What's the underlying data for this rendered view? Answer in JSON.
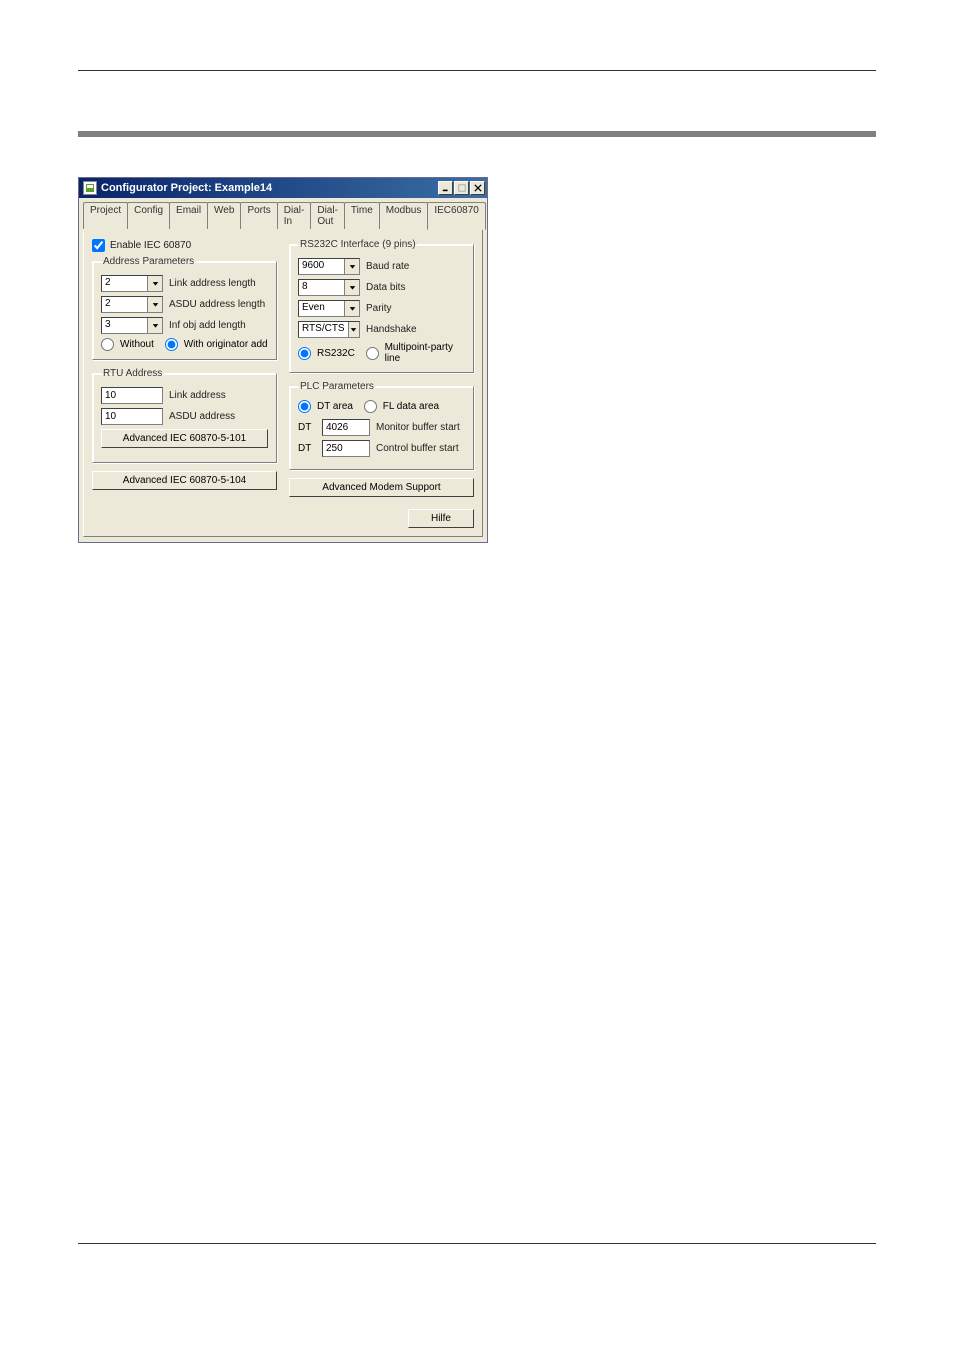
{
  "window": {
    "title": "Configurator Project: Example14"
  },
  "tabs": [
    "Project",
    "Config",
    "Email",
    "Web",
    "Ports",
    "Dial-In",
    "Dial-Out",
    "Time",
    "Modbus",
    "IEC60870"
  ],
  "active_tab": "IEC60870",
  "enable_label": "Enable IEC 60870",
  "enable_checked": true,
  "address_params": {
    "legend": "Address Parameters",
    "link_address_length": {
      "value": "2",
      "label": "Link address length"
    },
    "asdu_address_length": {
      "value": "2",
      "label": "ASDU address length"
    },
    "inf_obj_add_length": {
      "value": "3",
      "label": "Inf obj add length"
    },
    "originator": {
      "without": "Without",
      "with": "With originator add",
      "selected": "with"
    }
  },
  "rtu_address": {
    "legend": "RTU Address",
    "link_address": {
      "value": "10",
      "label": "Link address"
    },
    "asdu_address": {
      "value": "10",
      "label": "ASDU address"
    }
  },
  "buttons": {
    "adv101": "Advanced IEC 60870-5-101",
    "adv104": "Advanced IEC 60870-5-104",
    "advmodem": "Advanced Modem Support",
    "help": "Hilfe"
  },
  "rs232": {
    "legend": "RS232C Interface (9 pins)",
    "baud": {
      "value": "9600",
      "label": "Baud rate"
    },
    "databits": {
      "value": "8",
      "label": "Data bits"
    },
    "parity": {
      "value": "Even",
      "label": "Parity"
    },
    "handshake": {
      "value": "RTS/CTS",
      "label": "Handshake"
    },
    "mode": {
      "rs232c": "RS232C",
      "multipoint": "Multipoint-party line",
      "selected": "rs232c"
    }
  },
  "plc": {
    "legend": "PLC Parameters",
    "area": {
      "dt": "DT area",
      "fl": "FL data area",
      "selected": "dt"
    },
    "monitor": {
      "prefix": "DT",
      "value": "4026",
      "label": "Monitor buffer start"
    },
    "control": {
      "prefix": "DT",
      "value": "250",
      "label": "Control buffer start"
    }
  }
}
